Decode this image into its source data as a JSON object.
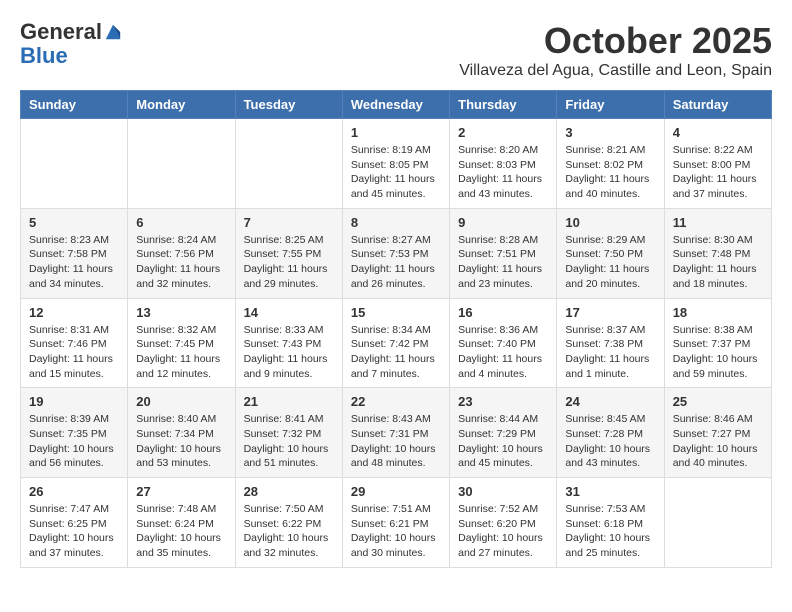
{
  "header": {
    "logo_general": "General",
    "logo_blue": "Blue",
    "month_title": "October 2025",
    "location": "Villaveza del Agua, Castille and Leon, Spain"
  },
  "weekdays": [
    "Sunday",
    "Monday",
    "Tuesday",
    "Wednesday",
    "Thursday",
    "Friday",
    "Saturday"
  ],
  "weeks": [
    [
      {
        "day": "",
        "info": ""
      },
      {
        "day": "",
        "info": ""
      },
      {
        "day": "",
        "info": ""
      },
      {
        "day": "1",
        "info": "Sunrise: 8:19 AM\nSunset: 8:05 PM\nDaylight: 11 hours and 45 minutes."
      },
      {
        "day": "2",
        "info": "Sunrise: 8:20 AM\nSunset: 8:03 PM\nDaylight: 11 hours and 43 minutes."
      },
      {
        "day": "3",
        "info": "Sunrise: 8:21 AM\nSunset: 8:02 PM\nDaylight: 11 hours and 40 minutes."
      },
      {
        "day": "4",
        "info": "Sunrise: 8:22 AM\nSunset: 8:00 PM\nDaylight: 11 hours and 37 minutes."
      }
    ],
    [
      {
        "day": "5",
        "info": "Sunrise: 8:23 AM\nSunset: 7:58 PM\nDaylight: 11 hours and 34 minutes."
      },
      {
        "day": "6",
        "info": "Sunrise: 8:24 AM\nSunset: 7:56 PM\nDaylight: 11 hours and 32 minutes."
      },
      {
        "day": "7",
        "info": "Sunrise: 8:25 AM\nSunset: 7:55 PM\nDaylight: 11 hours and 29 minutes."
      },
      {
        "day": "8",
        "info": "Sunrise: 8:27 AM\nSunset: 7:53 PM\nDaylight: 11 hours and 26 minutes."
      },
      {
        "day": "9",
        "info": "Sunrise: 8:28 AM\nSunset: 7:51 PM\nDaylight: 11 hours and 23 minutes."
      },
      {
        "day": "10",
        "info": "Sunrise: 8:29 AM\nSunset: 7:50 PM\nDaylight: 11 hours and 20 minutes."
      },
      {
        "day": "11",
        "info": "Sunrise: 8:30 AM\nSunset: 7:48 PM\nDaylight: 11 hours and 18 minutes."
      }
    ],
    [
      {
        "day": "12",
        "info": "Sunrise: 8:31 AM\nSunset: 7:46 PM\nDaylight: 11 hours and 15 minutes."
      },
      {
        "day": "13",
        "info": "Sunrise: 8:32 AM\nSunset: 7:45 PM\nDaylight: 11 hours and 12 minutes."
      },
      {
        "day": "14",
        "info": "Sunrise: 8:33 AM\nSunset: 7:43 PM\nDaylight: 11 hours and 9 minutes."
      },
      {
        "day": "15",
        "info": "Sunrise: 8:34 AM\nSunset: 7:42 PM\nDaylight: 11 hours and 7 minutes."
      },
      {
        "day": "16",
        "info": "Sunrise: 8:36 AM\nSunset: 7:40 PM\nDaylight: 11 hours and 4 minutes."
      },
      {
        "day": "17",
        "info": "Sunrise: 8:37 AM\nSunset: 7:38 PM\nDaylight: 11 hours and 1 minute."
      },
      {
        "day": "18",
        "info": "Sunrise: 8:38 AM\nSunset: 7:37 PM\nDaylight: 10 hours and 59 minutes."
      }
    ],
    [
      {
        "day": "19",
        "info": "Sunrise: 8:39 AM\nSunset: 7:35 PM\nDaylight: 10 hours and 56 minutes."
      },
      {
        "day": "20",
        "info": "Sunrise: 8:40 AM\nSunset: 7:34 PM\nDaylight: 10 hours and 53 minutes."
      },
      {
        "day": "21",
        "info": "Sunrise: 8:41 AM\nSunset: 7:32 PM\nDaylight: 10 hours and 51 minutes."
      },
      {
        "day": "22",
        "info": "Sunrise: 8:43 AM\nSunset: 7:31 PM\nDaylight: 10 hours and 48 minutes."
      },
      {
        "day": "23",
        "info": "Sunrise: 8:44 AM\nSunset: 7:29 PM\nDaylight: 10 hours and 45 minutes."
      },
      {
        "day": "24",
        "info": "Sunrise: 8:45 AM\nSunset: 7:28 PM\nDaylight: 10 hours and 43 minutes."
      },
      {
        "day": "25",
        "info": "Sunrise: 8:46 AM\nSunset: 7:27 PM\nDaylight: 10 hours and 40 minutes."
      }
    ],
    [
      {
        "day": "26",
        "info": "Sunrise: 7:47 AM\nSunset: 6:25 PM\nDaylight: 10 hours and 37 minutes."
      },
      {
        "day": "27",
        "info": "Sunrise: 7:48 AM\nSunset: 6:24 PM\nDaylight: 10 hours and 35 minutes."
      },
      {
        "day": "28",
        "info": "Sunrise: 7:50 AM\nSunset: 6:22 PM\nDaylight: 10 hours and 32 minutes."
      },
      {
        "day": "29",
        "info": "Sunrise: 7:51 AM\nSunset: 6:21 PM\nDaylight: 10 hours and 30 minutes."
      },
      {
        "day": "30",
        "info": "Sunrise: 7:52 AM\nSunset: 6:20 PM\nDaylight: 10 hours and 27 minutes."
      },
      {
        "day": "31",
        "info": "Sunrise: 7:53 AM\nSunset: 6:18 PM\nDaylight: 10 hours and 25 minutes."
      },
      {
        "day": "",
        "info": ""
      }
    ]
  ]
}
